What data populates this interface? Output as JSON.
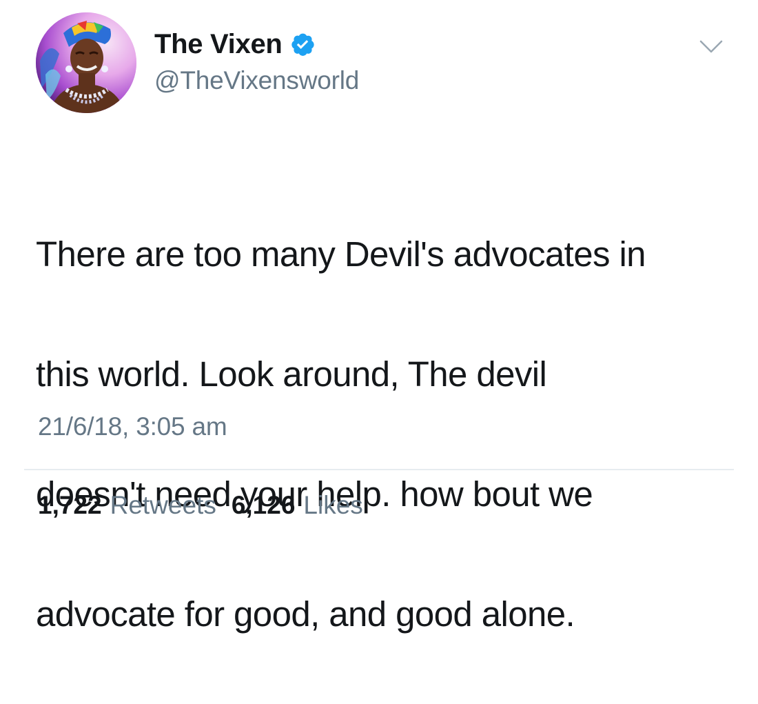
{
  "author": {
    "display_name": "The Vixen",
    "handle": "@TheVixensworld",
    "verified": true,
    "avatar_icon": "profile-photo"
  },
  "tweet": {
    "lines": [
      "There are too many Devil's advocates in",
      "this world. Look around, The devil",
      "doesn't need your help. how bout we",
      "advocate for good, and good alone."
    ],
    "timestamp": "21/6/18, 3:05 am"
  },
  "stats": {
    "retweets_count": "1,722",
    "retweets_label": "Retweets",
    "likes_count": "6,126",
    "likes_label": "Likes"
  },
  "colors": {
    "verified_blue": "#1da1f2",
    "secondary_text": "#657786",
    "primary_text": "#14171a",
    "divider": "#e6ecf0"
  },
  "icons": {
    "verified": "verified-badge-icon",
    "menu": "chevron-down-icon"
  }
}
